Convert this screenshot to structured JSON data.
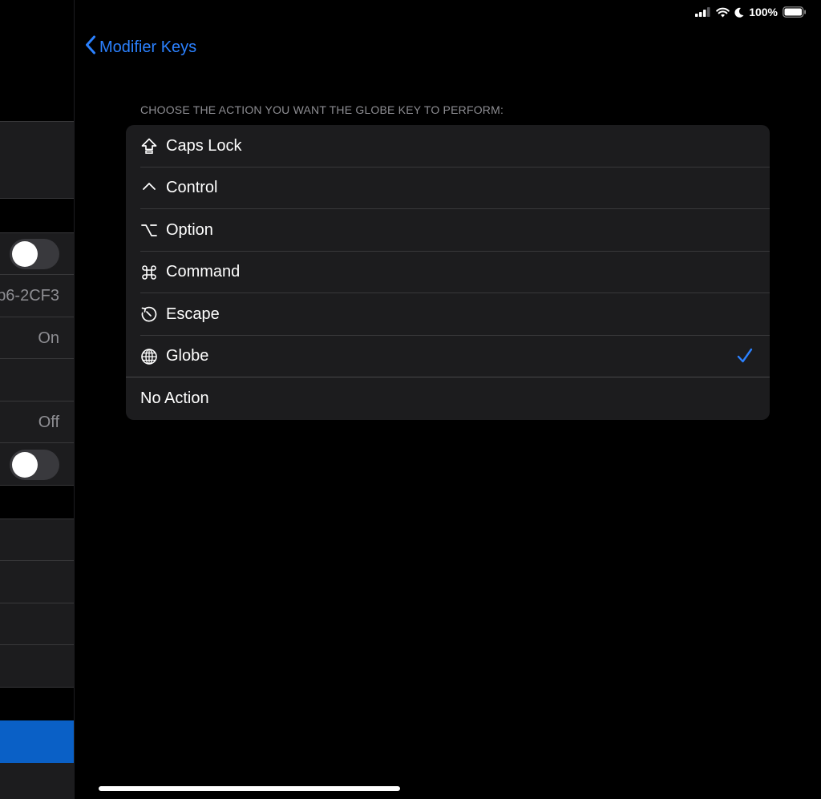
{
  "status": {
    "battery": "100%"
  },
  "sidebar": {
    "id_partial": "b6-2CF3",
    "value_on": "On",
    "value_off": "Off"
  },
  "nav": {
    "back_label": "Modifier Keys"
  },
  "section": {
    "header": "CHOOSE THE ACTION YOU WANT THE GLOBE KEY TO PERFORM:"
  },
  "options": [
    {
      "label": "Caps Lock",
      "icon": "caps-lock-icon"
    },
    {
      "label": "Control",
      "icon": "control-icon"
    },
    {
      "label": "Option",
      "icon": "option-icon"
    },
    {
      "label": "Command",
      "icon": "command-icon"
    },
    {
      "label": "Escape",
      "icon": "escape-icon"
    },
    {
      "label": "Globe",
      "icon": "globe-icon",
      "selected": true
    },
    {
      "label": "No Action"
    }
  ],
  "colors": {
    "accent": "#2b81ff",
    "background": "#000000",
    "cell": "#1c1c1e"
  }
}
